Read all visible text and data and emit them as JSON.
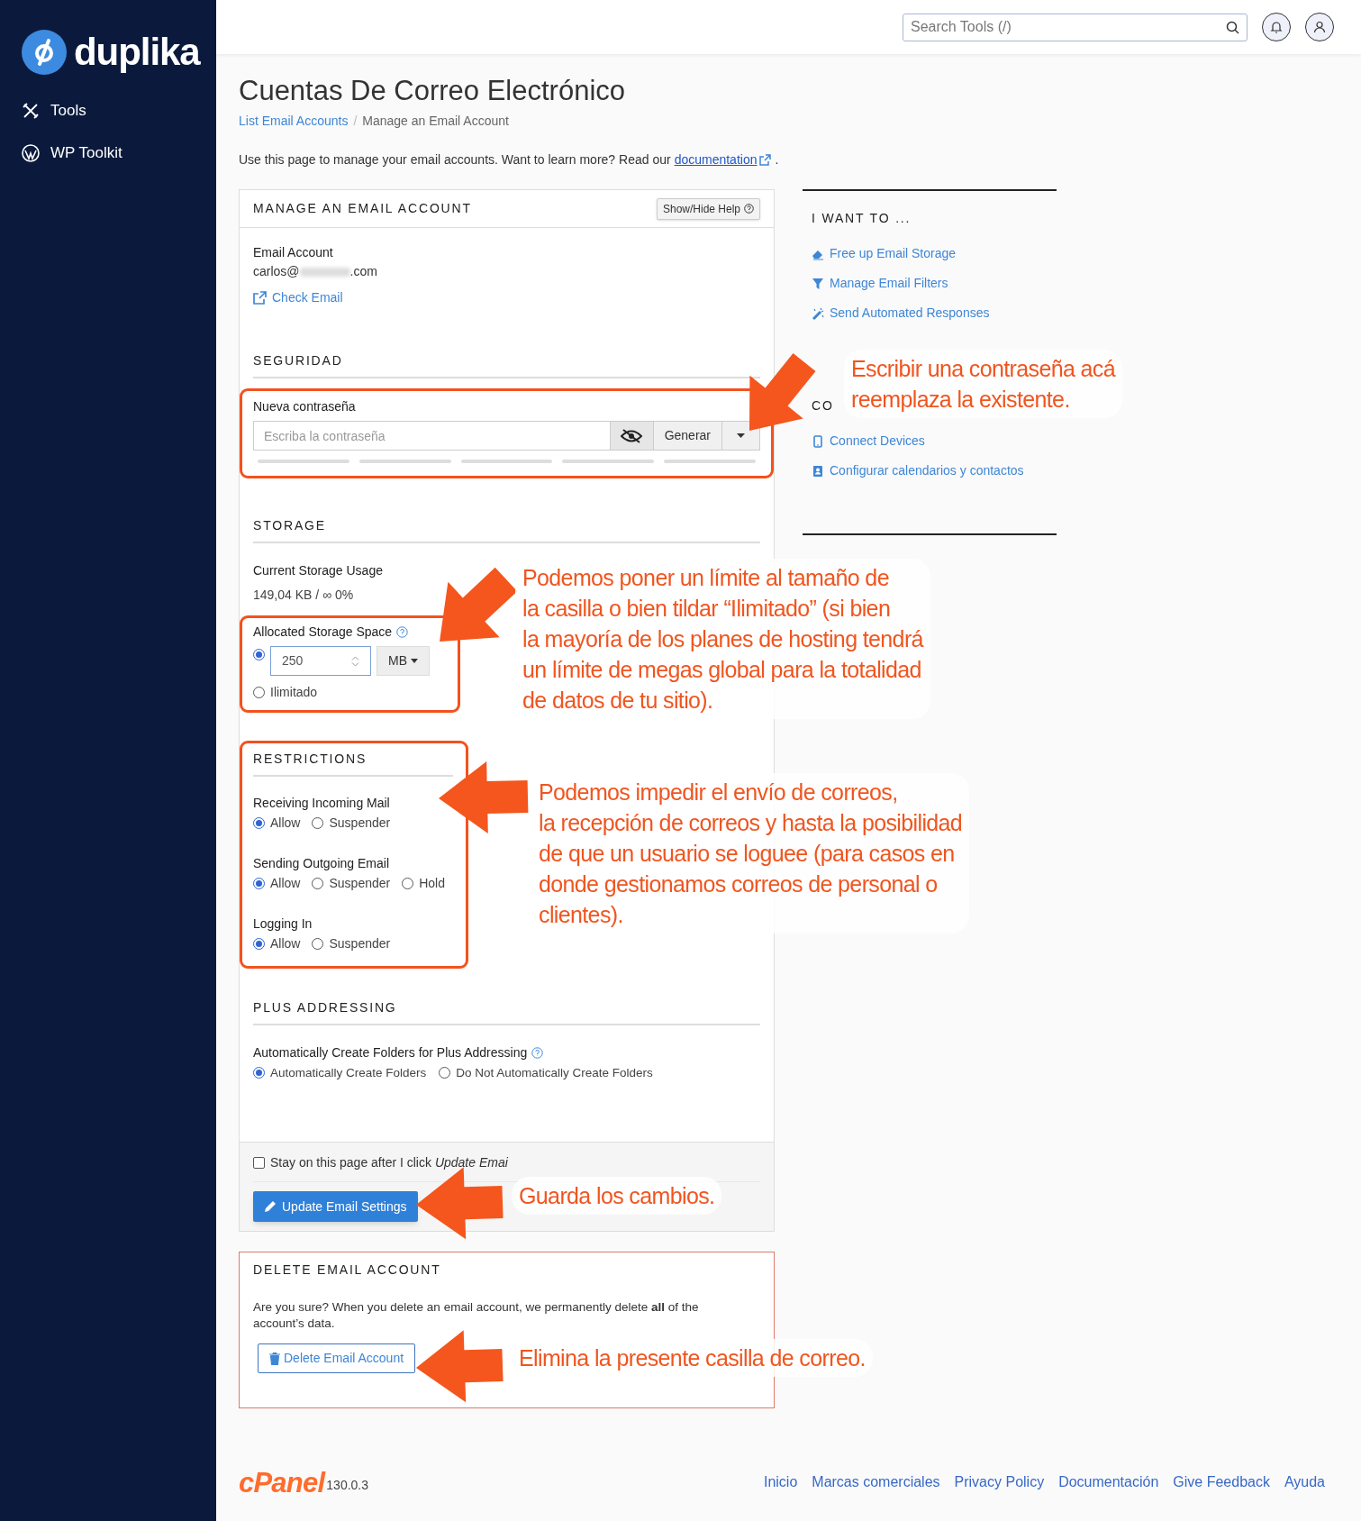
{
  "sidebar": {
    "logo": "duplika",
    "items": [
      {
        "label": "Tools",
        "selected": false
      },
      {
        "label": "WP Toolkit",
        "selected": false
      }
    ]
  },
  "topbar": {
    "search": {
      "placeholder": "Search Tools (/)"
    }
  },
  "page": {
    "title": "Cuentas De Correo Electrónico",
    "breadcrumb_separator": "/",
    "breadcrumb": [
      {
        "label": "List Email Accounts",
        "link": true
      },
      {
        "label": "Manage an Email Account",
        "link": false
      }
    ],
    "intro": "Use this page to manage your email accounts. Want to learn more? Read our",
    "intro_link": "documentation",
    "intro_end": "."
  },
  "manage_card": {
    "title": "MANAGE AN EMAIL ACCOUNT",
    "help_button": "Show/Hide Help",
    "account_label": "Email Account",
    "account_prefix": "carlos@",
    "account_suffix": ".com",
    "check_email": "Check Email",
    "security": {
      "heading": "SEGURIDAD",
      "highlighted": true,
      "label": "Nueva contraseña",
      "placeholder": "Escriba la contraseña",
      "generate": "Generar"
    },
    "storage": {
      "heading": "STORAGE",
      "usage_label": "Current Storage Usage",
      "usage_value": "149,04 KB / ∞ 0%",
      "allocated_label": "Allocated Storage Space",
      "highlighted": true,
      "options": [
        {
          "kind": "quota",
          "selected": true,
          "value": "250",
          "unit": "MB"
        },
        {
          "kind": "label",
          "selected": false,
          "label": "Ilimitado"
        }
      ]
    },
    "restrictions": {
      "heading": "RESTRICTIONS",
      "highlighted": true,
      "groups": [
        {
          "label": "Receiving Incoming Mail",
          "options": [
            {
              "label": "Allow",
              "selected": true
            },
            {
              "label": "Suspender",
              "selected": false
            }
          ]
        },
        {
          "label": "Sending Outgoing Email",
          "options": [
            {
              "label": "Allow",
              "selected": true
            },
            {
              "label": "Suspender",
              "selected": false
            },
            {
              "label": "Hold",
              "selected": false
            }
          ]
        },
        {
          "label": "Logging In",
          "options": [
            {
              "label": "Allow",
              "selected": true
            },
            {
              "label": "Suspender",
              "selected": false
            }
          ]
        }
      ]
    },
    "plus": {
      "heading": "PLUS ADDRESSING",
      "label": "Automatically Create Folders for Plus Addressing",
      "options": [
        {
          "label": "Automatically Create Folders",
          "selected": true
        },
        {
          "label": "Do Not Automatically Create Folders",
          "selected": false
        }
      ]
    },
    "stay": {
      "text": "Stay on this page after I click *Update Emai*",
      "checked": false
    },
    "update_button": "Update Email Settings"
  },
  "delete_card": {
    "title": "DELETE EMAIL ACCOUNT",
    "text": "Are you sure? When you delete an email account, we permanently delete **all** of the account’s data.",
    "button": "Delete Email Account"
  },
  "side_panel": {
    "heading": "I WANT TO ...",
    "links": [
      "Free up Email Storage",
      "Manage Email Filters",
      "Send Automated Responses"
    ],
    "heading_2": "CO",
    "links_2": [
      "Connect Devices",
      "Configurar calendarios y contactos"
    ]
  },
  "footer": {
    "logo": "cPanel",
    "version": "130.0.3",
    "links": [
      "Inicio",
      "Marcas comerciales",
      "Privacy Policy",
      "Documentación",
      "Give Feedback",
      "Ayuda"
    ]
  },
  "annotations": [
    {
      "lines": [
        "Escribir una contraseña acá",
        "reemplaza la existente."
      ]
    },
    {
      "lines": [
        "Podemos poner un límite al tamaño de",
        "la casilla o bien tildar “Ilimitado” (si bien",
        "la mayoría de los planes de hosting tendrá",
        "un límite de megas global para la totalidad",
        "de datos de tu sitio)."
      ]
    },
    {
      "lines": [
        "Podemos impedir el envío de correos,",
        "la recepción de correos y hasta la posibilidad",
        "de que un usuario se loguee (para casos en",
        "donde gestionamos correos de personal o",
        "clientes)."
      ]
    },
    {
      "lines": [
        "Guarda los cambios."
      ]
    },
    {
      "lines": [
        "Elimina la presente casilla de correo."
      ]
    }
  ]
}
